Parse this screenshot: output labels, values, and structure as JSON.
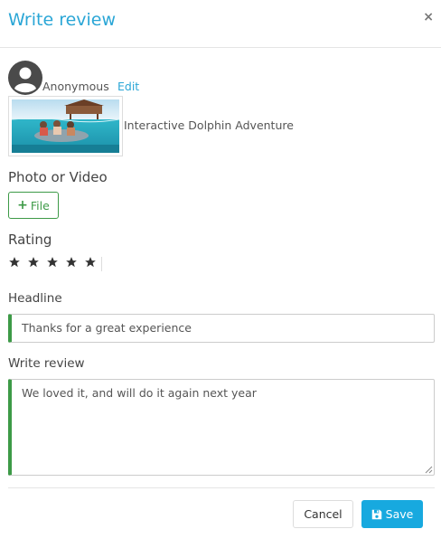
{
  "modal": {
    "title": "Write review",
    "close_label": "×"
  },
  "user": {
    "name": "Anonymous",
    "edit_label": "Edit"
  },
  "product": {
    "name": "Interactive Dolphin Adventure"
  },
  "media": {
    "label": "Photo or Video",
    "file_button": "File"
  },
  "rating": {
    "label": "Rating",
    "value": 5,
    "max": 5
  },
  "headline": {
    "label": "Headline",
    "value": "Thanks for a great experience"
  },
  "review": {
    "label": "Write review",
    "value": "We loved it, and will do it again next year"
  },
  "actions": {
    "cancel_label": "Cancel",
    "save_label": "Save"
  },
  "colors": {
    "accent": "#2aa6d6",
    "save_button": "#17a9df",
    "success_green": "#3d9a47",
    "star": "#333333"
  },
  "icons": {
    "close": "close-icon",
    "avatar": "user-avatar-icon",
    "plus": "plus-icon",
    "star": "star-icon",
    "save": "floppy-disk-icon"
  }
}
